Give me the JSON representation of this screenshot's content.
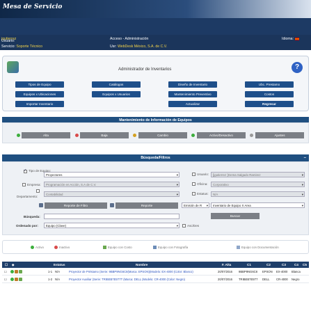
{
  "header": {
    "brand": "Mesa de Servicio",
    "usuario_label": "Usuario:",
    "usuario_value": "jgutierrez",
    "servicio_label": "Servicio:",
    "servicio_value": "Soporte Técnico",
    "section": "Acceso - Administración",
    "usr_label": "Usr:",
    "company": "WebDesk México, S.A. de C.V.",
    "idioma_label": "Idioma:"
  },
  "admin": {
    "title": "Administrador de Inventarios",
    "buttons": [
      "Tipos de Equipo",
      "Catálogos",
      "Diseño de Inventario",
      "Ubc. Prestamo",
      "Equipos x Ubicaciones",
      "Equipos x Usuarios",
      "Mantenimiento Preventivo",
      "Costos",
      "Importar Inventario",
      "Actualizar",
      "Regresar"
    ]
  },
  "maintenance": {
    "title": "Mantenimiento de Información de Equipos",
    "buttons": [
      "Alta",
      "Baja",
      "Cambio",
      "Activo/Desactivo",
      "Ajustes"
    ]
  },
  "search": {
    "title": "Búsqueda/Filtros",
    "tipo_equipo_label": "Tipo de Equipo:",
    "tipo_equipo_value": "Proyectores",
    "empresa_label": "Empresa:",
    "empresa_value": "Programación en Acción, S.A de C.V.",
    "departamento_label": "Departamento:",
    "departamento_value": "Contabilidad",
    "usuario_label": "Usuario:",
    "usuario_value": "[jgutierrez ]Gema Salgado Ramirez",
    "oficina_label": "Oficina:",
    "oficina_value": "Corporativo",
    "estatus_label": "Estatus:",
    "estatus_value": "N/A",
    "reporte_filtro": "Reporte de Filtro",
    "reporte": "Reporte",
    "emision_value": "Emisión de R",
    "inventario_value": "Inventario de Equipo X Area",
    "busqueda_label": "Búsqueda:",
    "buscar": "Buscar",
    "ordenado_label": "Ordenado por:",
    "ordenado_value": "Equipo (Clave)",
    "ascdes": "Asc/Des"
  },
  "legend": [
    "Activo",
    "Inactivo",
    "Equipo con Costo",
    "Equipo con Fotografía",
    "Equipo con Documentación"
  ],
  "table": {
    "headers": [
      "Estatus",
      "Nombre",
      "F. Alta",
      "C1",
      "C2",
      "C3",
      "C4",
      "C5"
    ],
    "rows": [
      {
        "num": "1-1",
        "estatus": "N/A",
        "nombre": "Proyector de Préstamo (Serie: 9BBP9NG6C8(Marca: EPSON)(Modelo: EX-4000 (Color: Blanco)",
        "fecha": "20/07/2016",
        "c1": "9BBP9NG6C8",
        "c2": "EPSON",
        "c3": "EX-4000",
        "c4": "Blanca"
      },
      {
        "num": "1-2",
        "estatus": "N/A",
        "nombre": "Proyector Auxiliar (Serie: TRIBEB7E5T7T (Marca: DELL (Modelo: CR-4000 (Color: Negro)",
        "fecha": "20/07/2016",
        "c1": "TRIBEB7E5T7",
        "c2": "DELL",
        "c3": "CR-4000",
        "c4": "Negro"
      }
    ]
  },
  "colors": {
    "navy": "#1d3a64",
    "button_blue": "#1e4f8a",
    "grey_button": "#7b7f86",
    "active_green": "#3cae3c",
    "inactive_red": "#d94a4a"
  }
}
